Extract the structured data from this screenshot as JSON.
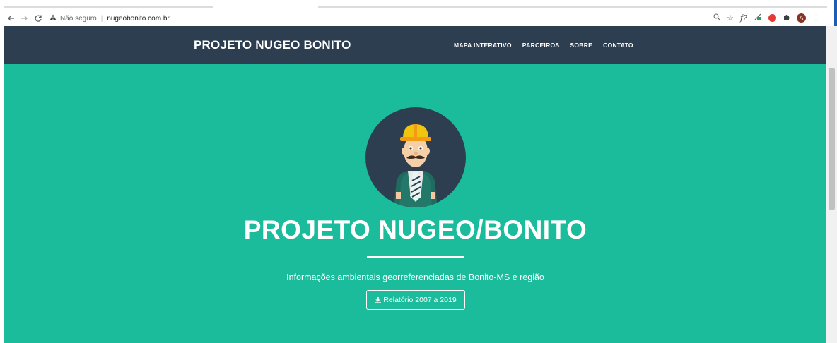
{
  "browser": {
    "security_label": "Não seguro",
    "url": "nugeobonito.com.br",
    "icons": [
      "back-icon",
      "forward-icon",
      "reload-icon",
      "warning-icon",
      "zoom-icon",
      "star-icon",
      "fx-extension-icon",
      "green-extension-icon",
      "red-extension-icon",
      "puzzle-icon",
      "profile-avatar",
      "menu-dots-icon"
    ],
    "avatar_letter": "A"
  },
  "navbar": {
    "brand": "PROJETO NUGEO BONITO",
    "menu": [
      "MAPA INTERATIVO",
      "PARCEIROS",
      "SOBRE",
      "CONTATO"
    ],
    "bg_color": "#2c3e50"
  },
  "hero": {
    "title": "PROJETO NUGEO/BONITO",
    "subtitle": "Informações ambientais georreferenciadas de Bonito-MS e região",
    "button_label": "Relatório 2007 a 2019",
    "bg_color": "#1abc9c"
  }
}
